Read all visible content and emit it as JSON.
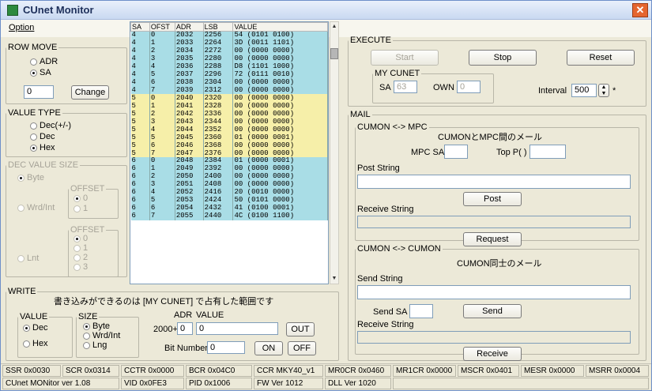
{
  "window": {
    "title": "CUnet Monitor",
    "close_glyph": "✕",
    "menu": [
      "Option"
    ]
  },
  "rowmove": {
    "legend": "ROW MOVE",
    "opt_adr": "ADR",
    "opt_sa": "SA",
    "selected": "SA",
    "input_value": "0",
    "change_btn": "Change"
  },
  "valuetype": {
    "legend": "VALUE TYPE",
    "opts": [
      "Dec(+/-)",
      "Dec",
      "Hex"
    ],
    "selected": "Hex"
  },
  "decsize": {
    "legend": "DEC VALUE SIZE",
    "byte": "Byte",
    "wrd": "Wrd/Int",
    "lnt": "Lnt",
    "offset": "OFFSET",
    "offset_byte": [
      "0",
      "1"
    ],
    "offset_lnt": [
      "0",
      "1",
      "2",
      "3"
    ]
  },
  "grid": {
    "headers": [
      "SA",
      "OFST",
      "ADR",
      "LSB",
      "VALUE"
    ],
    "rows": [
      [
        "4",
        "0",
        "2032",
        "2256",
        "54 (0101 0100)"
      ],
      [
        "4",
        "1",
        "2033",
        "2264",
        "3D (0011 1101)"
      ],
      [
        "4",
        "2",
        "2034",
        "2272",
        "00 (0000 0000)"
      ],
      [
        "4",
        "3",
        "2035",
        "2280",
        "00 (0000 0000)"
      ],
      [
        "4",
        "4",
        "2036",
        "2288",
        "D8 (1101 1000)"
      ],
      [
        "4",
        "5",
        "2037",
        "2296",
        "72 (0111 0010)"
      ],
      [
        "4",
        "6",
        "2038",
        "2304",
        "00 (0000 0000)"
      ],
      [
        "4",
        "7",
        "2039",
        "2312",
        "00 (0000 0000)"
      ],
      [
        "5",
        "0",
        "2040",
        "2320",
        "00 (0000 0000)"
      ],
      [
        "5",
        "1",
        "2041",
        "2328",
        "00 (0000 0000)"
      ],
      [
        "5",
        "2",
        "2042",
        "2336",
        "00 (0000 0000)"
      ],
      [
        "5",
        "3",
        "2043",
        "2344",
        "00 (0000 0000)"
      ],
      [
        "5",
        "4",
        "2044",
        "2352",
        "00 (0000 0000)"
      ],
      [
        "5",
        "5",
        "2045",
        "2360",
        "01 (0000 0001)"
      ],
      [
        "5",
        "6",
        "2046",
        "2368",
        "00 (0000 0000)"
      ],
      [
        "5",
        "7",
        "2047",
        "2376",
        "00 (0000 0000)"
      ],
      [
        "6",
        "0",
        "2048",
        "2384",
        "01 (0000 0001)"
      ],
      [
        "6",
        "1",
        "2049",
        "2392",
        "00 (0000 0000)"
      ],
      [
        "6",
        "2",
        "2050",
        "2400",
        "00 (0000 0000)"
      ],
      [
        "6",
        "3",
        "2051",
        "2408",
        "00 (0000 0000)"
      ],
      [
        "6",
        "4",
        "2052",
        "2416",
        "20 (0010 0000)"
      ],
      [
        "6",
        "5",
        "2053",
        "2424",
        "50 (0101 0000)"
      ],
      [
        "6",
        "6",
        "2054",
        "2432",
        "41 (0100 0001)"
      ],
      [
        "6",
        "7",
        "2055",
        "2440",
        "4C (0100 1100)"
      ]
    ],
    "colors": {
      "sa4": "#a9dde6",
      "sa5": "#f6efa9",
      "sa6": "#a9dde6"
    },
    "scroll_up": "▲",
    "scroll_down": "▼"
  },
  "write": {
    "legend": "WRITE",
    "note": "書き込みができるのは [MY CUNET] で占有した範囲です",
    "value_legend": "VALUE",
    "size_legend": "SIZE",
    "val_dec": "Dec",
    "val_hex": "Hex",
    "sz_byte": "Byte",
    "sz_wrd": "Wrd/Int",
    "sz_lng": "Lng",
    "adr_label": "ADR",
    "value_label": "VALUE",
    "adr_prefix": "2000+",
    "adr_value": "0",
    "value_value": "0",
    "out_btn": "OUT",
    "bit_label": "Bit Number",
    "bit_value": "0",
    "on_btn": "ON",
    "off_btn": "OFF"
  },
  "execute": {
    "legend": "EXECUTE",
    "start": "Start",
    "stop": "Stop",
    "reset": "Reset",
    "mycunet_legend": "MY CUNET",
    "sa_label": "SA",
    "sa_value": "63",
    "own_label": "OWN",
    "own_value": "0",
    "interval_label": "Interval",
    "interval_value": "500",
    "interval_unit": "*"
  },
  "mail": {
    "legend": "MAIL",
    "mpc": {
      "legend": "CUMON <-> MPC",
      "title": "CUMONとMPC間のメール",
      "mpc_sa_label": "MPC SA",
      "top_p_label": "Top P( )",
      "post_string": "Post String",
      "post_btn": "Post",
      "receive_string": "Receive String",
      "request_btn": "Request"
    },
    "cumon": {
      "legend": "CUMON <-> CUMON",
      "title": "CUMON同士のメール",
      "send_string": "Send String",
      "send_sa_label": "Send SA",
      "send_btn": "Send",
      "receive_string": "Receive String",
      "receive_btn": "Receive"
    }
  },
  "status": {
    "row1": [
      "SSR 0x0030",
      "SCR 0x0314",
      "CCTR 0x0000",
      "BCR 0x04C0",
      "CCR MKY40_v1",
      "MR0CR 0x0460",
      "MR1CR 0x0000",
      "MSCR 0x0401",
      "MESR 0x0000",
      "MSRR 0x0004"
    ],
    "row2": [
      "CUnet MONitor ver 1.08",
      "VID 0x0FE3",
      "PID 0x1006",
      "FW Ver 1012",
      "DLL Ver 1020"
    ]
  }
}
